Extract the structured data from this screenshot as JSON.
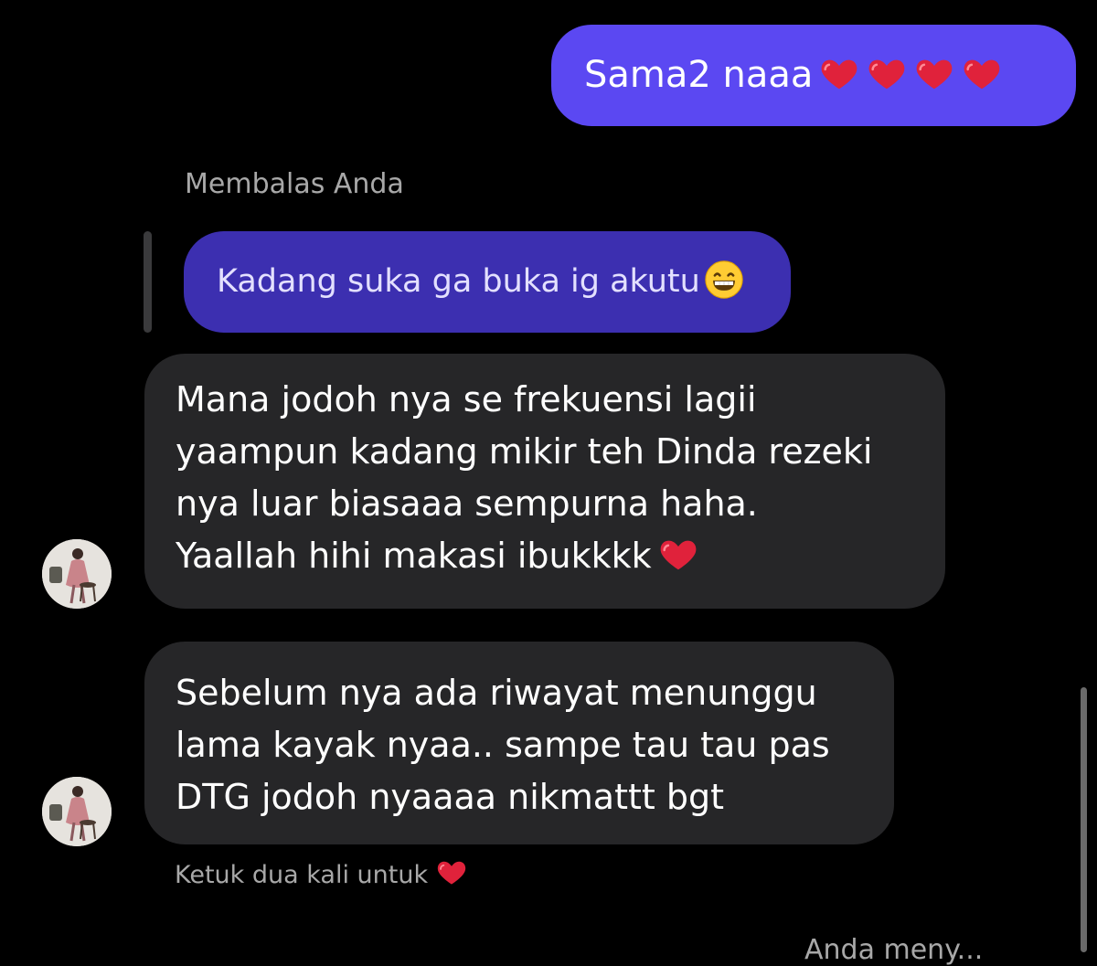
{
  "messages": {
    "sent_text": "Sama2 naaa",
    "reply_label": "Membalas Anda",
    "quoted_text": "Kadang suka ga buka ig akutu",
    "received_1": {
      "line1": "Mana jodoh nya se frekuensi lagii",
      "line2": "yaampun kadang mikir teh Dinda rezeki",
      "line3": "nya luar biasaaa sempurna haha.",
      "line4": "Yaallah hihi makasi ibukkkk"
    },
    "received_2": {
      "line1": "Sebelum nya ada riwayat menunggu",
      "line2": "lama kayak nyaa.. sampe tau tau pas",
      "line3": "DTG jodoh nyaaaa nikmattt bgt"
    },
    "double_tap_hint": "Ketuk dua kali untuk",
    "partial_bottom_text": "Anda meny..."
  },
  "icons": {
    "heart": "red-heart-emoji",
    "grin": "grinning-face-emoji",
    "avatar": "contact-avatar"
  },
  "colors": {
    "background": "#000000",
    "sent_bubble": "#5b48f2",
    "quoted_bubble": "#3c2fb0",
    "received_bubble": "#262628",
    "secondary_text": "#a8a8a8",
    "heart": "#e0223b"
  }
}
